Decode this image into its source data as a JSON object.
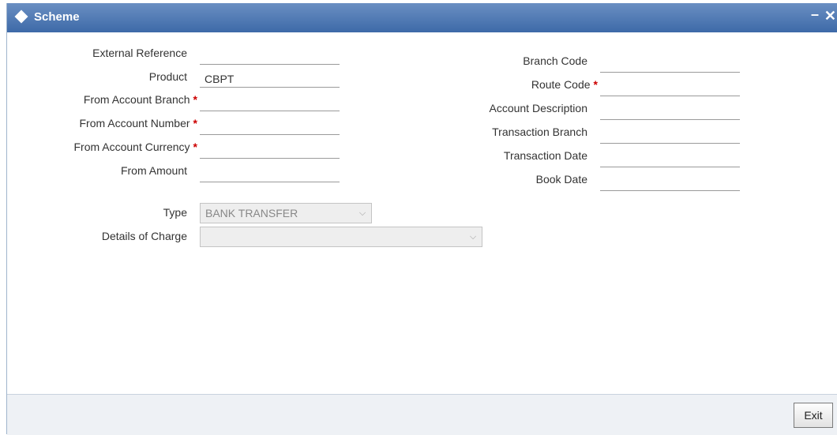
{
  "window": {
    "title": "Scheme",
    "minimize_glyph": "–",
    "close_glyph": "✕"
  },
  "left_fields": [
    {
      "label": "External Reference",
      "value": "",
      "required": false
    },
    {
      "label": "Product",
      "value": "CBPT",
      "required": false
    },
    {
      "label": "From Account Branch",
      "value": "",
      "required": true
    },
    {
      "label": "From Account Number",
      "value": "",
      "required": true
    },
    {
      "label": "From Account Currency",
      "value": "",
      "required": true
    },
    {
      "label": "From Amount",
      "value": "",
      "required": false
    }
  ],
  "right_fields": [
    {
      "label": "Branch Code",
      "value": "",
      "required": false
    },
    {
      "label": "Route Code",
      "value": "",
      "required": true
    },
    {
      "label": "Account Description",
      "value": "",
      "required": false
    },
    {
      "label": "Transaction Branch",
      "value": "",
      "required": false
    },
    {
      "label": "Transaction Date",
      "value": "",
      "required": false
    },
    {
      "label": "Book Date",
      "value": "",
      "required": false
    }
  ],
  "type_select": {
    "label": "Type",
    "value": "BANK TRANSFER"
  },
  "charge_select": {
    "label": "Details of Charge",
    "value": ""
  },
  "footer": {
    "exit_label": "Exit"
  },
  "required_marker": "*"
}
